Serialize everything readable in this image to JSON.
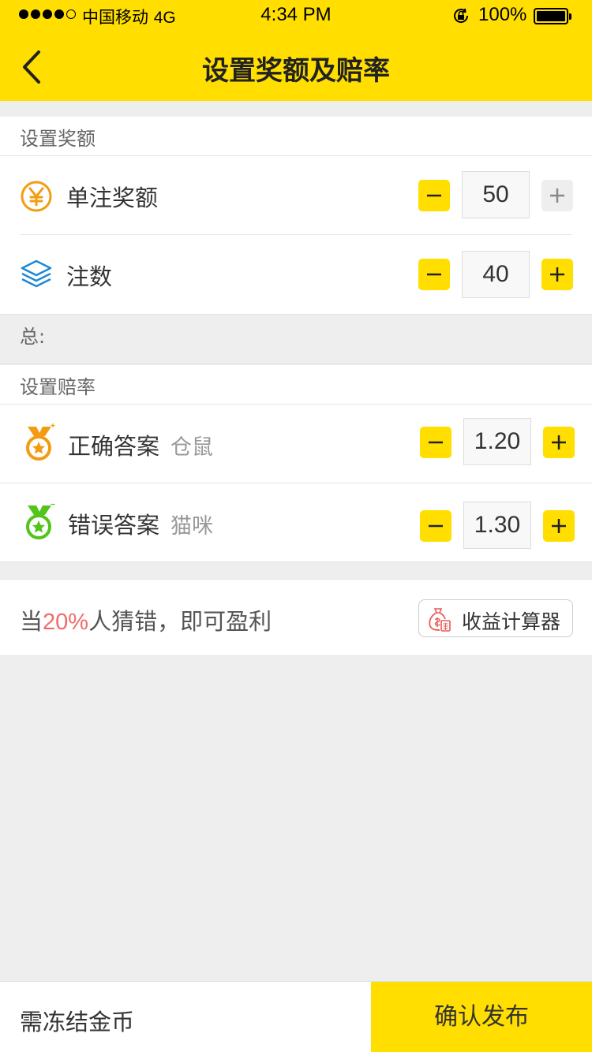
{
  "status_bar": {
    "carrier": "中国移动",
    "network": "4G",
    "time": "4:34 PM",
    "battery": "100%",
    "signal_bars_filled": 4,
    "signal_bars_total": 5
  },
  "nav": {
    "title": "设置奖额及赔率",
    "back_icon": "chevron-left-icon"
  },
  "prize_section": {
    "heading": "设置奖额",
    "rows": [
      {
        "icon": "yen-coin-icon",
        "label": "单注奖额",
        "value": "50",
        "minus": "−",
        "plus": "+",
        "plus_enabled": false
      },
      {
        "icon": "layers-icon",
        "label": "注数",
        "value": "40",
        "minus": "−",
        "plus": "+",
        "plus_enabled": true
      }
    ],
    "total_label": "总:"
  },
  "odds_section": {
    "heading": "设置赔率",
    "rows": [
      {
        "icon": "orange-medal-icon",
        "label": "正确答案",
        "answer": "仓鼠",
        "value": "1.20"
      },
      {
        "icon": "green-medal-icon",
        "label": "错误答案",
        "answer": "猫咪",
        "value": "1.30"
      }
    ]
  },
  "profit": {
    "prefix": "当",
    "percent": "20%",
    "suffix": "人猜错，即可盈利",
    "calc_button": "收益计算器",
    "calc_icon": "money-bag-calculator-icon"
  },
  "footer": {
    "freeze_label": "需冻结金币",
    "confirm_label": "确认发布"
  },
  "colors": {
    "accent": "#ffde00",
    "highlight_red": "#f06c6c",
    "orange_icon": "#f39c12",
    "blue_icon": "#1e88d6",
    "green_icon": "#52c41a"
  }
}
